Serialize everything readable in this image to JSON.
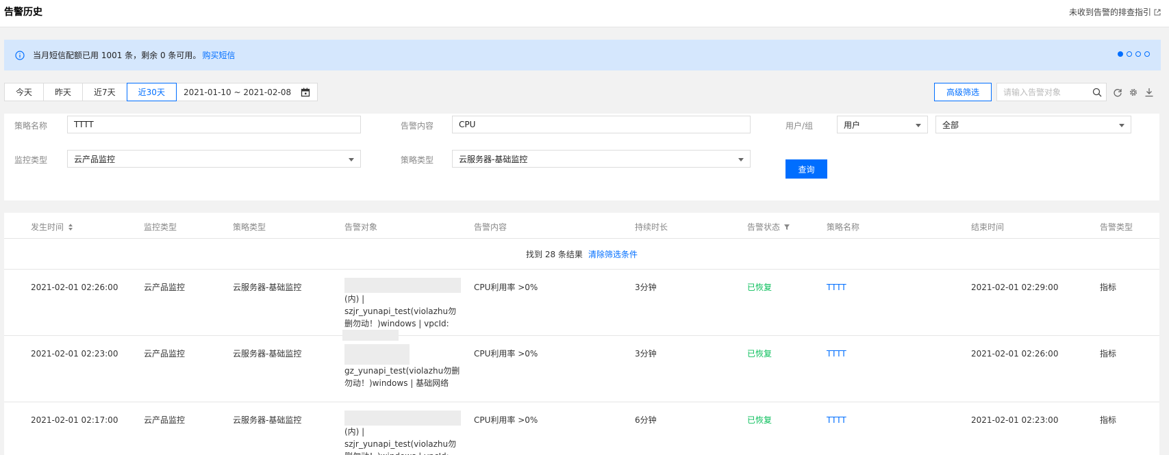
{
  "header": {
    "title": "告警历史",
    "help_link": "未收到告警的排查指引"
  },
  "notice": {
    "text": "当月短信配额已用 1001 条，剩余 0 条可用。",
    "link": "购买短信",
    "dots_count": 4,
    "active_dot": 0
  },
  "toolbar": {
    "today": "今天",
    "yesterday": "昨天",
    "last7": "近7天",
    "last30": "近30天",
    "active": "近30天",
    "date_range": "2021-01-10 ~ 2021-02-08",
    "advanced_filter": "高级筛选",
    "search_placeholder": "请输入告警对象"
  },
  "filters": {
    "policy_name_label": "策略名称",
    "policy_name_value": "TTTT",
    "alarm_content_label": "告警内容",
    "alarm_content_value": "CPU",
    "user_group_label": "用户/组",
    "user_group_type": "用户",
    "user_group_value": "全部",
    "monitor_type_label": "监控类型",
    "monitor_type_value": "云产品监控",
    "policy_type_label": "策略类型",
    "policy_type_value": "云服务器-基础监控",
    "query_button": "查询"
  },
  "table": {
    "columns": [
      "发生时间",
      "监控类型",
      "策略类型",
      "告警对象",
      "告警内容",
      "持续时长",
      "告警状态",
      "策略名称",
      "结束时间",
      "告警类型"
    ],
    "result_text": "找到 28 条结果",
    "clear_filters": "清除筛选条件",
    "rows": [
      {
        "time": "2021-02-01 02:26:00",
        "monitor_type": "云产品监控",
        "policy_type": "云服务器-基础监控",
        "object": "(内) | szjr_yunapi_test(violazhu勿删勿动！)windows | vpcId:",
        "content": "CPU利用率 >0%",
        "duration": "3分钟",
        "status": "已恢复",
        "policy_name": "TTTT",
        "end_time": "2021-02-01 02:29:00",
        "alarm_type": "指标"
      },
      {
        "time": "2021-02-01 02:23:00",
        "monitor_type": "云产品监控",
        "policy_type": "云服务器-基础监控",
        "object": "gz_yunapi_test(violazhu勿删勿动！)windows | 基础网络",
        "content": "CPU利用率 >0%",
        "duration": "3分钟",
        "status": "已恢复",
        "policy_name": "TTTT",
        "end_time": "2021-02-01 02:26:00",
        "alarm_type": "指标"
      },
      {
        "time": "2021-02-01 02:17:00",
        "monitor_type": "云产品监控",
        "policy_type": "云服务器-基础监控",
        "object": "(内) | szjr_yunapi_test(violazhu勿删勿动！)windows | vpcId:",
        "content": "CPU利用率 >0%",
        "duration": "6分钟",
        "status": "已恢复",
        "policy_name": "TTTT",
        "end_time": "2021-02-01 02:23:00",
        "alarm_type": "指标"
      }
    ]
  }
}
